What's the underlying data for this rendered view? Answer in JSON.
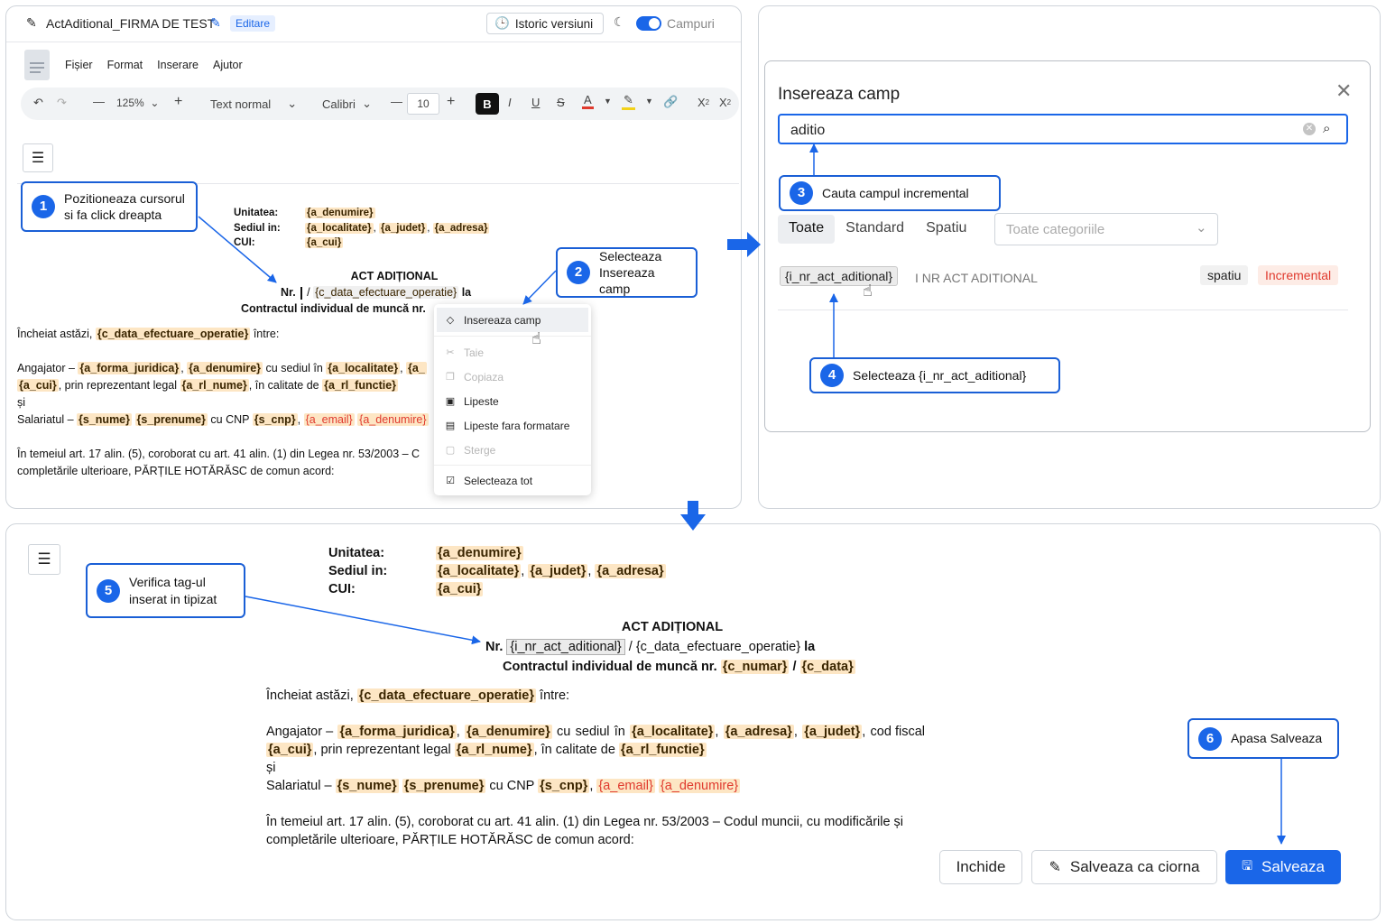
{
  "editor": {
    "doc_title": "ActAditional_FIRMA DE TEST",
    "mode_badge": "Editare",
    "history_label": "Istoric versiuni",
    "fields_toggle_label": "Campuri",
    "menu": [
      "Fișier",
      "Format",
      "Inserare",
      "Ajutor"
    ],
    "zoom": "125%",
    "style": "Text normal",
    "font": "Calibri",
    "font_size": "10",
    "bold_label": "B",
    "italic_label": "I",
    "underline_label": "U",
    "strike_label": "S",
    "color_label": "A"
  },
  "doc": {
    "unit_label": "Unitatea:",
    "seat_label": "Sediul in:",
    "cui_label": "CUI:",
    "unit_value": "{a_denumire}",
    "seat_values": [
      "{a_localitate}",
      "{a_judet}",
      "{a_adresa}"
    ],
    "seat_values_b": [
      "{a_localitate}",
      "{a_judet}",
      "{a_adresa}"
    ],
    "cui_value": "{a_cui}",
    "title": "ACT ADIȚIONAL",
    "nr_prefix": "Nr.",
    "nr_sep": "/",
    "date_tag": "{c_data_efectuare_operatie}",
    "la": "la",
    "contract_text": "Contractul individual de muncă nr.",
    "c_numar": "{c_numar}",
    "c_data": "{c_data}",
    "concluded_text": "Încheiat astăzi,",
    "between": "între:",
    "employer_text": "Angajator –",
    "a_forma_juridica": "{a_forma_juridica}",
    "a_denumire": "{a_denumire}",
    "cu_sediul": "cu sediul în",
    "a_localitate": "{a_localitate}",
    "a_adresa": "{a_adresa}",
    "a_judet": "{a_judet}",
    "a_trunc": "{a_",
    "cod_fiscal": "cod fiscal",
    "a_cui": "{a_cui}",
    "legal_rep": "prin reprezentant legal",
    "a_rl_nume": "{a_rl_nume}",
    "in_calitate": "în calitate de",
    "a_rl_functie": "{a_rl_functie}",
    "si": "și",
    "employee_text": "Salariatul –",
    "s_nume": "{s_nume}",
    "s_prenume": "{s_prenume}",
    "cnp_text": "cu CNP",
    "s_cnp": "{s_cnp}",
    "a_email": "{a_email}",
    "legal_text_1": "În temeiul art. 17 alin. (5), coroborat cu art. 41 alin. (1) din Legea nr. 53/2003 – Codul muncii, cu modificările și",
    "legal_text_1_trunc": "În temeiul art. 17 alin. (5), coroborat cu art. 41 alin. (1) din Legea nr. 53/2003 – C",
    "legal_text_2": "completările ulterioare, PĂRȚILE HOTĂRĂSC de comun acord:",
    "inserted_tag": "{i_nr_act_aditional}"
  },
  "context_menu": {
    "items": [
      {
        "label": "Insereaza camp",
        "icon": "tag-icon",
        "enabled": true
      },
      {
        "label": "Taie",
        "icon": "scissors-icon",
        "enabled": false
      },
      {
        "label": "Copiaza",
        "icon": "copy-icon",
        "enabled": false
      },
      {
        "label": "Lipeste",
        "icon": "paste-icon",
        "enabled": true
      },
      {
        "label": "Lipeste fara formatare",
        "icon": "paste-plain-icon",
        "enabled": true
      },
      {
        "label": "Sterge",
        "icon": "trash-icon",
        "enabled": false
      },
      {
        "label": "Selecteaza tot",
        "icon": "select-all-icon",
        "enabled": true
      }
    ]
  },
  "insert_dialog": {
    "title": "Insereaza camp",
    "search_value": "aditio",
    "tabs": [
      "Toate",
      "Standard",
      "Spatiu"
    ],
    "category_placeholder": "Toate categoriile",
    "result": {
      "tag": "{i_nr_act_aditional}",
      "description": "I NR ACT ADITIONAL",
      "badge_type": "spatiu",
      "badge_kind": "Incremental"
    }
  },
  "callouts": {
    "c1": {
      "num": "1",
      "text": "Pozitioneaza cursorul si fa click dreapta"
    },
    "c2": {
      "num": "2",
      "text": "Selecteaza Insereaza camp"
    },
    "c3": {
      "num": "3",
      "text": "Cauta campul incremental"
    },
    "c4": {
      "num": "4",
      "text": "Selecteaza {i_nr_act_aditional}"
    },
    "c5": {
      "num": "5",
      "text": "Verifica tag-ul inserat in tipizat"
    },
    "c6": {
      "num": "6",
      "text": "Apasa Salveaza"
    }
  },
  "footer": {
    "close_label": "Inchide",
    "draft_label": "Salveaza ca ciorna",
    "save_label": "Salveaza"
  },
  "colors": {
    "accent": "#1a66e8",
    "tag_bg": "#fde6c4",
    "incremental": "#e03a2e"
  }
}
